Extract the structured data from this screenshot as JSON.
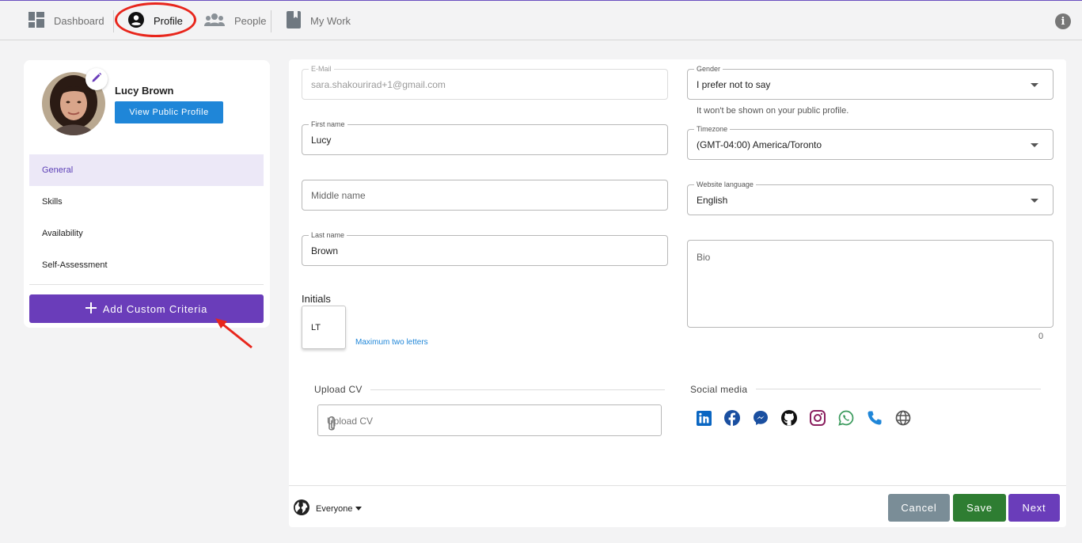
{
  "nav": {
    "items": [
      {
        "label": "Dashboard",
        "icon": "dashboard-icon"
      },
      {
        "label": "Profile",
        "icon": "account-circle-icon"
      },
      {
        "label": "People",
        "icon": "people-icon"
      },
      {
        "label": "My Work",
        "icon": "bookmark-icon"
      }
    ],
    "info_icon": "info-icon",
    "info_glyph": "i"
  },
  "sidebar": {
    "user_name": "Lucy Brown",
    "view_profile_label": "View Public Profile",
    "menu": [
      {
        "label": "General",
        "active": true
      },
      {
        "label": "Skills",
        "active": false
      },
      {
        "label": "Availability",
        "active": false
      },
      {
        "label": "Self-Assessment",
        "active": false
      }
    ],
    "add_criteria_label": "Add Custom Criteria"
  },
  "form": {
    "email": {
      "label": "E-Mail",
      "value": "sara.shakourirad+1@gmail.com"
    },
    "first_name": {
      "label": "First name",
      "value": "Lucy"
    },
    "middle_name": {
      "placeholder": "Middle name"
    },
    "last_name": {
      "label": "Last name",
      "value": "Brown"
    },
    "initials": {
      "label": "Initials",
      "value": "LT",
      "helper": "Maximum two letters"
    },
    "gender": {
      "label": "Gender",
      "value": "I prefer not to say",
      "helper": "It won't be shown on your public profile."
    },
    "timezone": {
      "label": "Timezone",
      "value": "(GMT-04:00) America/Toronto"
    },
    "language": {
      "label": "Website language",
      "value": "English"
    },
    "bio": {
      "placeholder": "Bio",
      "count": "0"
    },
    "upload_cv": {
      "section_title": "Upload CV",
      "placeholder": "Upload CV"
    },
    "social": {
      "section_title": "Social media",
      "icons": [
        "linkedin-icon",
        "facebook-icon",
        "messenger-icon",
        "github-icon",
        "instagram-icon",
        "whatsapp-icon",
        "phone-icon",
        "globe-icon"
      ]
    }
  },
  "footer": {
    "visibility": "Everyone",
    "cancel_label": "Cancel",
    "save_label": "Save",
    "next_label": "Next"
  },
  "colors": {
    "accent": "#6a3dba",
    "primary_blue": "#1f86d8",
    "save_green": "#2e7d32",
    "cancel_gray": "#7a8d97",
    "annotation_red": "#e8261c"
  }
}
